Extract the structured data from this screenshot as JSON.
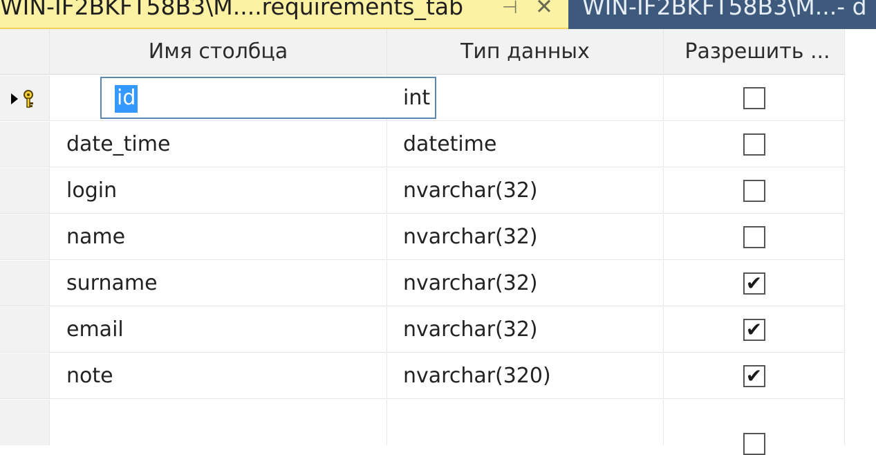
{
  "tabs": {
    "active_title": "WIN-IF2BKFT58B3\\M....requirements_tab",
    "pin_glyph": "⊣",
    "close_glyph": "✕",
    "inactive_title": "WIN-IF2BKFT58B3\\M...- d"
  },
  "grid": {
    "headers": {
      "column_name": "Имя столбца",
      "data_type": "Тип данных",
      "allow_nulls": "Разрешить ..."
    },
    "rows": [
      {
        "name": "id",
        "type": "int",
        "allow_nulls": false,
        "primary_key": true,
        "current": true
      },
      {
        "name": "date_time",
        "type": "datetime",
        "allow_nulls": false
      },
      {
        "name": "login",
        "type": "nvarchar(32)",
        "allow_nulls": false
      },
      {
        "name": "name",
        "type": "nvarchar(32)",
        "allow_nulls": false
      },
      {
        "name": "surname",
        "type": "nvarchar(32)",
        "allow_nulls": true
      },
      {
        "name": "email",
        "type": "nvarchar(32)",
        "allow_nulls": true
      },
      {
        "name": "note",
        "type": "nvarchar(320)",
        "allow_nulls": true
      },
      {
        "name": "",
        "type": "",
        "allow_nulls": false
      }
    ]
  },
  "icons": {
    "row_indicator": "current-row-arrow-icon",
    "primary_key": "key-icon",
    "checkmark": "✔"
  },
  "colors": {
    "active_tab": "#fdf1a3",
    "inactive_tab": "#3d5a7c",
    "selection": "#3399ff",
    "editor_border": "#5b86b4"
  }
}
